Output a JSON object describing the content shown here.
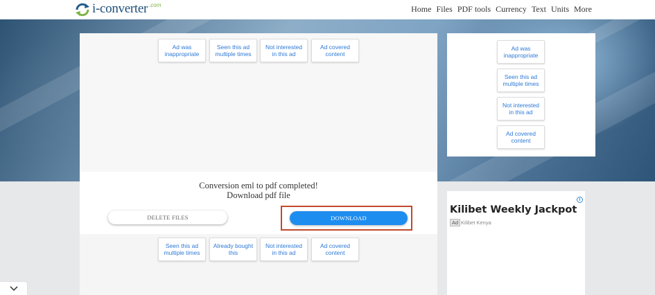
{
  "header": {
    "logo_text": "i-converter",
    "logo_suffix": ".com",
    "nav": [
      "Home",
      "Files",
      "PDF tools",
      "Currency",
      "Text",
      "Units",
      "More"
    ]
  },
  "ad_feedback_top": [
    "Ad was inappropriate",
    "Seen this ad multiple times",
    "Not interested in this ad",
    "Ad covered content"
  ],
  "ad_feedback_side": [
    "Ad was inappropriate",
    "Seen this ad multiple times",
    "Not interested in this ad",
    "Ad covered content"
  ],
  "ad_feedback_bottom": [
    "Seen this ad multiple times",
    "Already bought this",
    "Not interested in this ad",
    "Ad covered content"
  ],
  "conversion": {
    "title": "Conversion eml to pdf completed!",
    "subtitle": "Download pdf file",
    "delete_label": "DELETE FILES",
    "download_label": "DOWNLOAD"
  },
  "side_ad": {
    "headline": "Kilibet Weekly Jackpot",
    "badge": "Ad",
    "advertiser": "Kilibet Kenya",
    "info_glyph": "i"
  },
  "colors": {
    "accent": "#1e8df0",
    "highlight_frame": "#c0482a",
    "feedback_text": "#2d79d6"
  },
  "icons": [
    "refresh-logo-icon",
    "chevron-down-icon",
    "ad-info-icon"
  ]
}
